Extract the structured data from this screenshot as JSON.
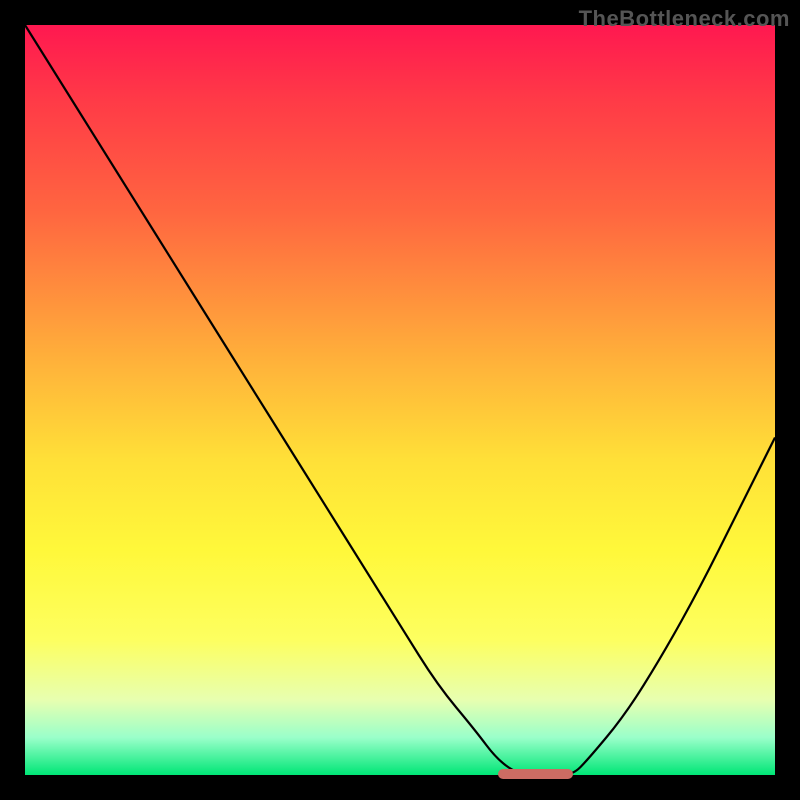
{
  "watermark": "TheBottleneck.com",
  "colors": {
    "frame": "#000000",
    "curve": "#000000",
    "min_band": "#cc6c63",
    "gradient_top": "#ff1850",
    "gradient_bottom": "#00e676"
  },
  "chart_data": {
    "type": "line",
    "title": "",
    "xlabel": "",
    "ylabel": "",
    "xlim": [
      0,
      100
    ],
    "ylim": [
      0,
      100
    ],
    "x": [
      0,
      5,
      10,
      15,
      20,
      25,
      30,
      35,
      40,
      45,
      50,
      55,
      60,
      63,
      66,
      70,
      73,
      75,
      80,
      85,
      90,
      95,
      100
    ],
    "y": [
      100,
      92,
      84,
      76,
      68,
      60,
      52,
      44,
      36,
      28,
      20,
      12,
      6,
      2,
      0,
      0,
      0,
      2,
      8,
      16,
      25,
      35,
      45
    ],
    "minimum_region": {
      "x_start": 63,
      "x_end": 73,
      "y": 0
    },
    "gradient_stops": [
      {
        "pos": 0.0,
        "color": "#ff1850"
      },
      {
        "pos": 0.1,
        "color": "#ff3a47"
      },
      {
        "pos": 0.25,
        "color": "#ff6640"
      },
      {
        "pos": 0.45,
        "color": "#ffb23a"
      },
      {
        "pos": 0.58,
        "color": "#ffe038"
      },
      {
        "pos": 0.7,
        "color": "#fff83a"
      },
      {
        "pos": 0.82,
        "color": "#fdff60"
      },
      {
        "pos": 0.9,
        "color": "#e7ffb0"
      },
      {
        "pos": 0.95,
        "color": "#9affca"
      },
      {
        "pos": 1.0,
        "color": "#00e676"
      }
    ]
  }
}
